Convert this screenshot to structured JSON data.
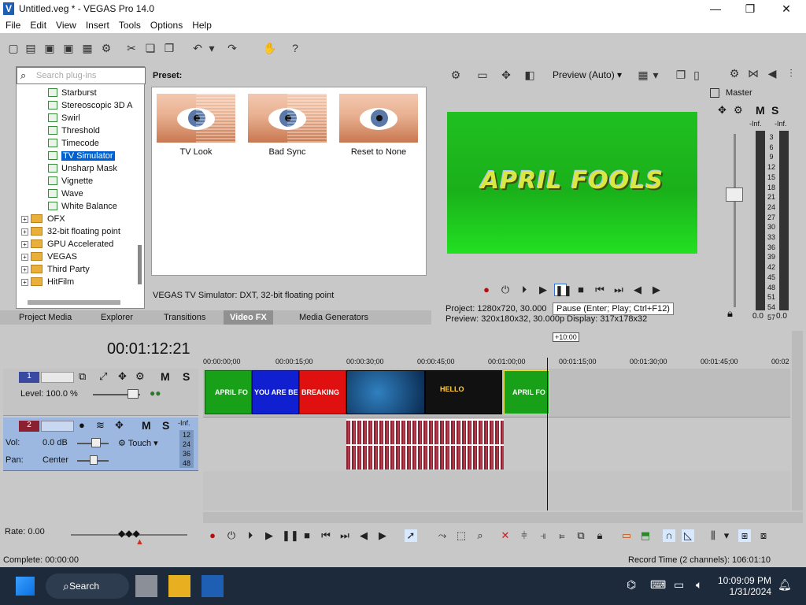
{
  "window": {
    "title": "Untitled.veg * - VEGAS Pro 14.0"
  },
  "menu": [
    "File",
    "Edit",
    "View",
    "Insert",
    "Tools",
    "Options",
    "Help"
  ],
  "plugins": {
    "search_placeholder": "Search plug-ins",
    "fx_items": [
      "Starburst",
      "Stereoscopic 3D A",
      "Swirl",
      "Threshold",
      "Timecode",
      "TV Simulator",
      "Unsharp Mask",
      "Vignette",
      "Wave",
      "White Balance"
    ],
    "selected": "TV Simulator",
    "folders": [
      "OFX",
      "32-bit floating point",
      "GPU Accelerated",
      "VEGAS",
      "Third Party",
      "HitFilm"
    ]
  },
  "presets": {
    "label": "Preset:",
    "items": [
      "TV Look",
      "Bad Sync",
      "Reset to None"
    ],
    "description": "VEGAS TV Simulator: DXT, 32-bit floating point"
  },
  "tabs": [
    "Project Media",
    "Explorer",
    "Transitions",
    "Video FX",
    "Media Generators"
  ],
  "active_tab": "Video FX",
  "preview": {
    "quality": "Preview (Auto)",
    "video_text": "APRIL FOOLS",
    "project_label": "Project:",
    "project_value": "1280x720, 30.000",
    "preview_label": "Preview:",
    "preview_value": "320x180x32, 30.000p",
    "display_label": "Display:",
    "display_value": "317x178x32",
    "tooltip": "Pause (Enter; Play; Ctrl+F12)"
  },
  "master": {
    "title": "Master",
    "m": "M",
    "s": "S",
    "inf_l": "-Inf.",
    "inf_r": "-Inf.",
    "scale": [
      "3",
      "6",
      "9",
      "12",
      "15",
      "18",
      "21",
      "24",
      "27",
      "30",
      "33",
      "36",
      "39",
      "42",
      "45",
      "48",
      "51",
      "54",
      "57"
    ],
    "bottom_l": "0.0",
    "bottom_r": "0.0"
  },
  "timeline": {
    "timecode": "00:01:12:21",
    "region_marker": "+10:00",
    "ruler": [
      "00:00:00;00",
      "00:00:15;00",
      "00:00:30;00",
      "00:00:45;00",
      "00:01:00;00",
      "00:01:15;00",
      "00:01:30;00",
      "00:01:45;00",
      "00:02"
    ],
    "track1": {
      "number": "1",
      "level": "Level: 100.0 %",
      "m": "M",
      "s": "S"
    },
    "track2": {
      "number": "2",
      "vol_label": "Vol:",
      "vol": "0.0 dB",
      "pan_label": "Pan:",
      "pan": "Center",
      "mode": "Touch",
      "m": "M",
      "s": "S",
      "inf": "-Inf.",
      "meter": [
        "12",
        "24",
        "36",
        "48"
      ]
    },
    "clip_text": [
      "APRIL FO",
      "YOU ARE BEING",
      "BREAKING",
      "",
      "HELLO",
      "APRIL FO"
    ],
    "rate": "Rate: 0.00"
  },
  "status": {
    "left": "Complete: 00:00:00",
    "right": "Record Time (2 channels): 106:01:10"
  },
  "taskbar": {
    "search": "Search",
    "time": "10:09:09 PM",
    "date": "1/31/2024"
  },
  "colors": {
    "accent": "#0060d0",
    "green_clip": "#18a018",
    "blue_clip": "#1020d0",
    "red_clip": "#e01010"
  }
}
